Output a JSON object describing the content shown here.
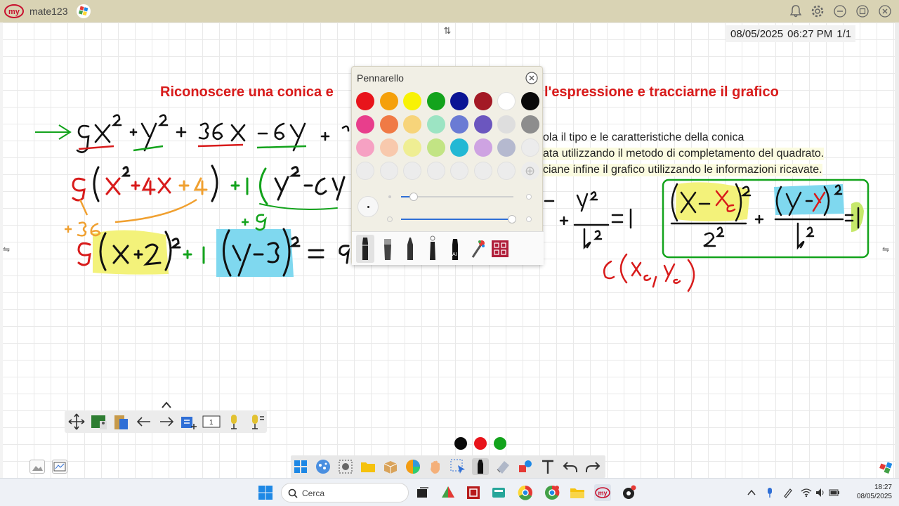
{
  "app": {
    "name": "mate123"
  },
  "board": {
    "date": "08/05/2025",
    "time": "06:27 PM",
    "page": "1/1",
    "heading_left": "Riconoscere una conica e",
    "heading_right": "l'espressione e tracciarne il grafico",
    "instructions": [
      "ola il tipo e le caratteristiche della conica",
      "ata utilizzando il metodo di completamento del quadrato.",
      "ciane infine il grafico utilizzando le informazioni ricavate."
    ]
  },
  "pen_panel": {
    "title": "Pennarello",
    "colors": [
      [
        "#e8141b",
        "#f5a00a",
        "#f8f205",
        "#13a31c",
        "#0b1494",
        "#a31925",
        "#ffffff",
        "#0a0a0a"
      ],
      [
        "#e83e8c",
        "#f07a45",
        "#f7d47a",
        "#9ce4c3",
        "#6a7bd4",
        "#6b56bf",
        "#dedede",
        "#8d8d8d"
      ],
      [
        "#f6a1c3",
        "#f8c9ad",
        "#efee93",
        "#c2e484",
        "#23b8d4",
        "#cea3e2",
        "#b5b9cf",
        "#ececec"
      ],
      [
        "#ececec",
        "#ececec",
        "#ececec",
        "#ececec",
        "#ececec",
        "#ececec",
        "#ececec",
        "add"
      ]
    ]
  },
  "taskbar": {
    "search_placeholder": "Cerca",
    "clock_time": "18:27",
    "clock_date": "08/05/2025"
  }
}
